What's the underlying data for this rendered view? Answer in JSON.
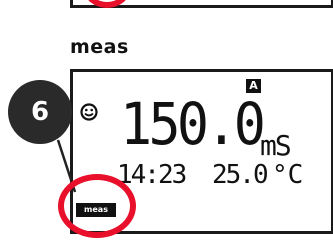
{
  "section": {
    "title": "meas"
  },
  "display": {
    "mode_indicator": "A",
    "status_icon": "smiley-icon",
    "main_value": "150.0",
    "main_unit": "mS",
    "time": "14:23",
    "temperature": "25.0",
    "temperature_unit": "°C",
    "mode_tag": "meas"
  },
  "callout": {
    "number": "6"
  },
  "colors": {
    "highlight": "#e8102a",
    "badge": "#2a2a2a",
    "display_ink": "#111111"
  }
}
